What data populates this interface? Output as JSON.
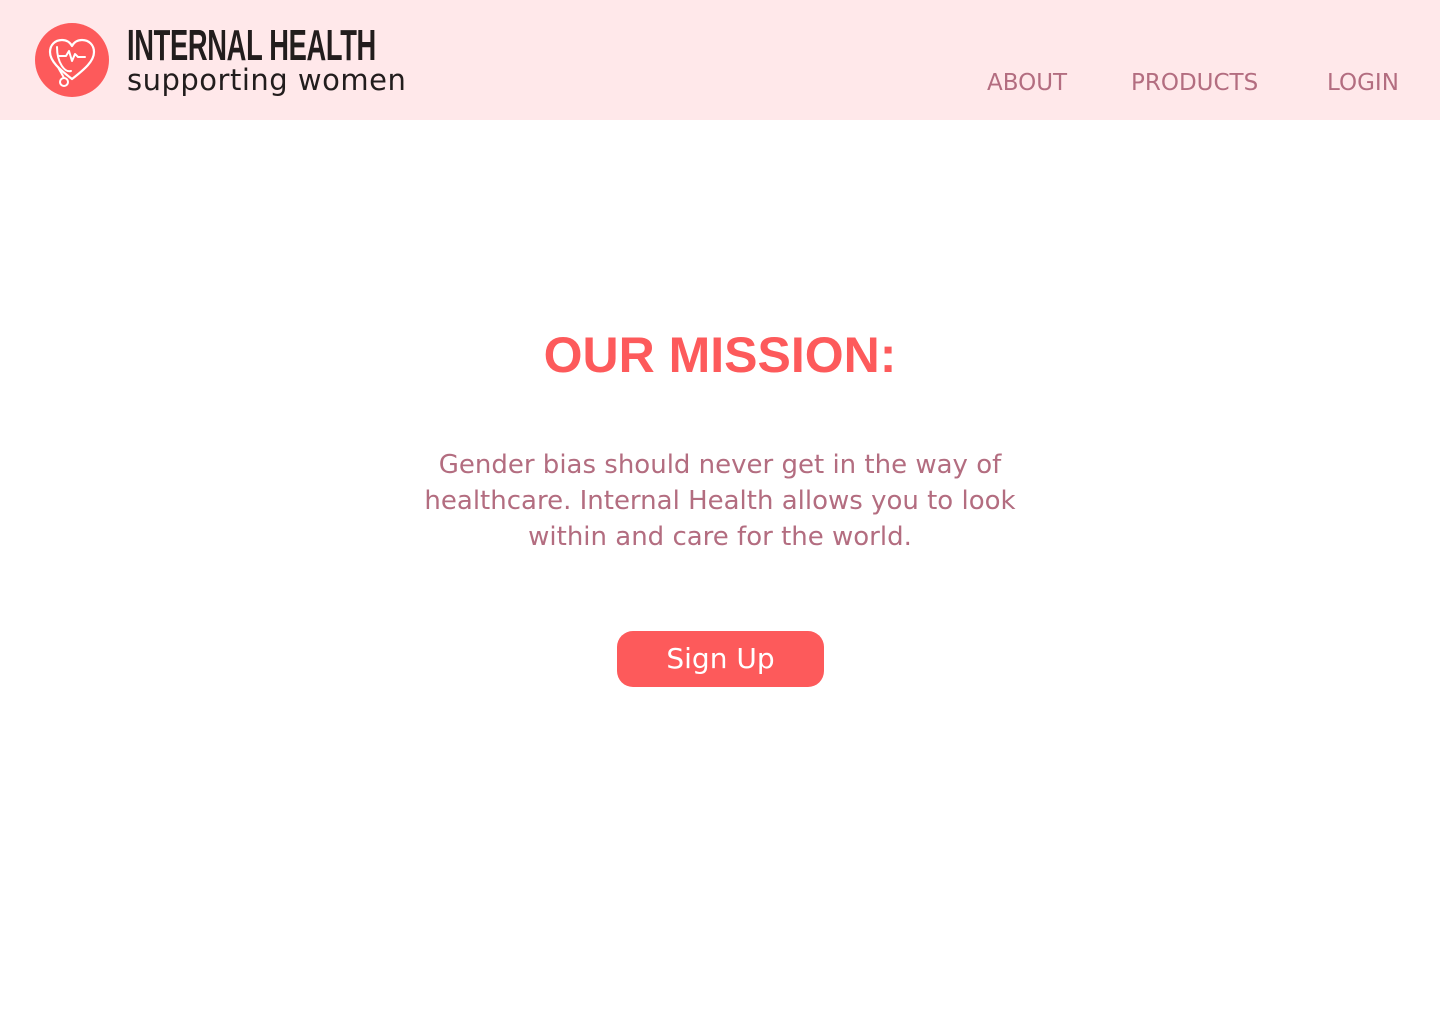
{
  "header": {
    "brand_title": "INTERNAL HEALTH",
    "brand_subtitle": "supporting women",
    "logo_icon": "heart-stethoscope-icon",
    "nav": [
      {
        "label": "ABOUT"
      },
      {
        "label": "PRODUCTS"
      },
      {
        "label": "LOGIN"
      }
    ]
  },
  "hero": {
    "title": "OUR MISSION:",
    "body": "Gender bias should never get in the way of healthcare. Internal Health allows you to look within and care for the world.",
    "cta_label": "Sign Up"
  },
  "colors": {
    "header_bg": "#ffe8ea",
    "accent": "#fd5a5b",
    "nav_text": "#b36d80",
    "brand_text": "#221d1d"
  }
}
